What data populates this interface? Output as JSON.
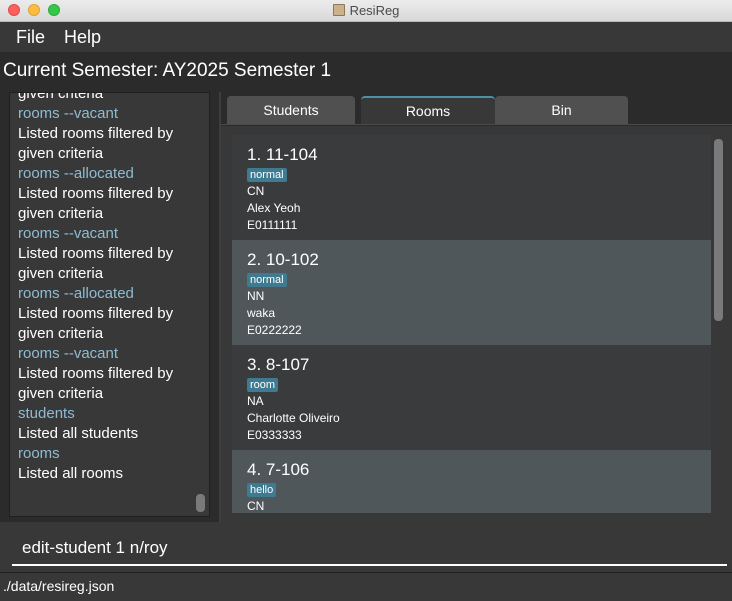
{
  "window": {
    "title": "ResiReg"
  },
  "menu": {
    "file": "File",
    "help": "Help"
  },
  "semester": "Current Semester: AY2025 Semester 1",
  "result_log": [
    {
      "cmd": "",
      "msg": "given criteria"
    },
    {
      "cmd": "rooms --vacant",
      "msg": "Listed rooms filtered by given criteria"
    },
    {
      "cmd": "rooms --allocated",
      "msg": "Listed rooms filtered by given criteria"
    },
    {
      "cmd": "rooms --vacant",
      "msg": "Listed rooms filtered by given criteria"
    },
    {
      "cmd": "rooms --allocated",
      "msg": "Listed rooms filtered by given criteria"
    },
    {
      "cmd": "rooms --vacant",
      "msg": "Listed rooms filtered by given criteria"
    },
    {
      "cmd": "students",
      "msg": "Listed all students"
    },
    {
      "cmd": "rooms",
      "msg": "Listed all rooms"
    }
  ],
  "tabs": [
    "Students",
    "Rooms",
    "Bin"
  ],
  "active_tab": "Rooms",
  "rooms": [
    {
      "title": "1.  11-104",
      "tag": "normal",
      "lines": [
        "CN",
        "Alex Yeoh",
        "E0111111"
      ]
    },
    {
      "title": "2.  10-102",
      "tag": "normal",
      "lines": [
        "NN",
        "waka",
        "E0222222"
      ]
    },
    {
      "title": "3.  8-107",
      "tag": "room",
      "lines": [
        "NA",
        "Charlotte Oliveiro",
        "E0333333"
      ]
    },
    {
      "title": "4.  7-106",
      "tag": "hello",
      "lines": [
        "CN"
      ]
    }
  ],
  "command": {
    "value": "edit-student 1 n/roy"
  },
  "status": {
    "path": "./data/resireg.json"
  },
  "colors": {
    "accent": "#3e7b91",
    "command_text": "#8fbcd4",
    "background": "#383838"
  }
}
